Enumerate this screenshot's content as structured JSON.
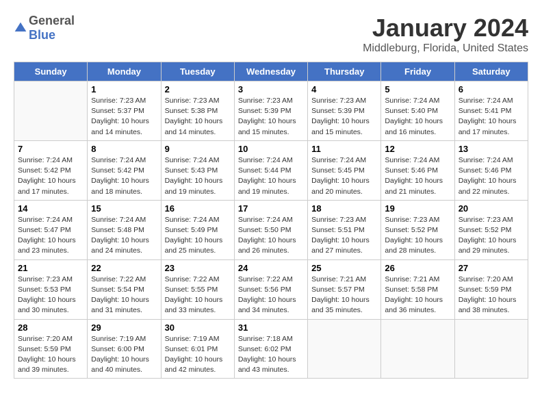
{
  "header": {
    "logo_general": "General",
    "logo_blue": "Blue",
    "title": "January 2024",
    "subtitle": "Middleburg, Florida, United States"
  },
  "columns": [
    "Sunday",
    "Monday",
    "Tuesday",
    "Wednesday",
    "Thursday",
    "Friday",
    "Saturday"
  ],
  "weeks": [
    [
      {
        "day": "",
        "sunrise": "",
        "sunset": "",
        "daylight": ""
      },
      {
        "day": "1",
        "sunrise": "7:23 AM",
        "sunset": "5:37 PM",
        "daylight": "10 hours and 14 minutes."
      },
      {
        "day": "2",
        "sunrise": "7:23 AM",
        "sunset": "5:38 PM",
        "daylight": "10 hours and 14 minutes."
      },
      {
        "day": "3",
        "sunrise": "7:23 AM",
        "sunset": "5:39 PM",
        "daylight": "10 hours and 15 minutes."
      },
      {
        "day": "4",
        "sunrise": "7:23 AM",
        "sunset": "5:39 PM",
        "daylight": "10 hours and 15 minutes."
      },
      {
        "day": "5",
        "sunrise": "7:24 AM",
        "sunset": "5:40 PM",
        "daylight": "10 hours and 16 minutes."
      },
      {
        "day": "6",
        "sunrise": "7:24 AM",
        "sunset": "5:41 PM",
        "daylight": "10 hours and 17 minutes."
      }
    ],
    [
      {
        "day": "7",
        "sunrise": "7:24 AM",
        "sunset": "5:42 PM",
        "daylight": "10 hours and 17 minutes."
      },
      {
        "day": "8",
        "sunrise": "7:24 AM",
        "sunset": "5:42 PM",
        "daylight": "10 hours and 18 minutes."
      },
      {
        "day": "9",
        "sunrise": "7:24 AM",
        "sunset": "5:43 PM",
        "daylight": "10 hours and 19 minutes."
      },
      {
        "day": "10",
        "sunrise": "7:24 AM",
        "sunset": "5:44 PM",
        "daylight": "10 hours and 19 minutes."
      },
      {
        "day": "11",
        "sunrise": "7:24 AM",
        "sunset": "5:45 PM",
        "daylight": "10 hours and 20 minutes."
      },
      {
        "day": "12",
        "sunrise": "7:24 AM",
        "sunset": "5:46 PM",
        "daylight": "10 hours and 21 minutes."
      },
      {
        "day": "13",
        "sunrise": "7:24 AM",
        "sunset": "5:46 PM",
        "daylight": "10 hours and 22 minutes."
      }
    ],
    [
      {
        "day": "14",
        "sunrise": "7:24 AM",
        "sunset": "5:47 PM",
        "daylight": "10 hours and 23 minutes."
      },
      {
        "day": "15",
        "sunrise": "7:24 AM",
        "sunset": "5:48 PM",
        "daylight": "10 hours and 24 minutes."
      },
      {
        "day": "16",
        "sunrise": "7:24 AM",
        "sunset": "5:49 PM",
        "daylight": "10 hours and 25 minutes."
      },
      {
        "day": "17",
        "sunrise": "7:24 AM",
        "sunset": "5:50 PM",
        "daylight": "10 hours and 26 minutes."
      },
      {
        "day": "18",
        "sunrise": "7:23 AM",
        "sunset": "5:51 PM",
        "daylight": "10 hours and 27 minutes."
      },
      {
        "day": "19",
        "sunrise": "7:23 AM",
        "sunset": "5:52 PM",
        "daylight": "10 hours and 28 minutes."
      },
      {
        "day": "20",
        "sunrise": "7:23 AM",
        "sunset": "5:52 PM",
        "daylight": "10 hours and 29 minutes."
      }
    ],
    [
      {
        "day": "21",
        "sunrise": "7:23 AM",
        "sunset": "5:53 PM",
        "daylight": "10 hours and 30 minutes."
      },
      {
        "day": "22",
        "sunrise": "7:22 AM",
        "sunset": "5:54 PM",
        "daylight": "10 hours and 31 minutes."
      },
      {
        "day": "23",
        "sunrise": "7:22 AM",
        "sunset": "5:55 PM",
        "daylight": "10 hours and 33 minutes."
      },
      {
        "day": "24",
        "sunrise": "7:22 AM",
        "sunset": "5:56 PM",
        "daylight": "10 hours and 34 minutes."
      },
      {
        "day": "25",
        "sunrise": "7:21 AM",
        "sunset": "5:57 PM",
        "daylight": "10 hours and 35 minutes."
      },
      {
        "day": "26",
        "sunrise": "7:21 AM",
        "sunset": "5:58 PM",
        "daylight": "10 hours and 36 minutes."
      },
      {
        "day": "27",
        "sunrise": "7:20 AM",
        "sunset": "5:59 PM",
        "daylight": "10 hours and 38 minutes."
      }
    ],
    [
      {
        "day": "28",
        "sunrise": "7:20 AM",
        "sunset": "5:59 PM",
        "daylight": "10 hours and 39 minutes."
      },
      {
        "day": "29",
        "sunrise": "7:19 AM",
        "sunset": "6:00 PM",
        "daylight": "10 hours and 40 minutes."
      },
      {
        "day": "30",
        "sunrise": "7:19 AM",
        "sunset": "6:01 PM",
        "daylight": "10 hours and 42 minutes."
      },
      {
        "day": "31",
        "sunrise": "7:18 AM",
        "sunset": "6:02 PM",
        "daylight": "10 hours and 43 minutes."
      },
      {
        "day": "",
        "sunrise": "",
        "sunset": "",
        "daylight": ""
      },
      {
        "day": "",
        "sunrise": "",
        "sunset": "",
        "daylight": ""
      },
      {
        "day": "",
        "sunrise": "",
        "sunset": "",
        "daylight": ""
      }
    ]
  ],
  "labels": {
    "sunrise_prefix": "Sunrise: ",
    "sunset_prefix": "Sunset: ",
    "daylight_prefix": "Daylight: "
  }
}
